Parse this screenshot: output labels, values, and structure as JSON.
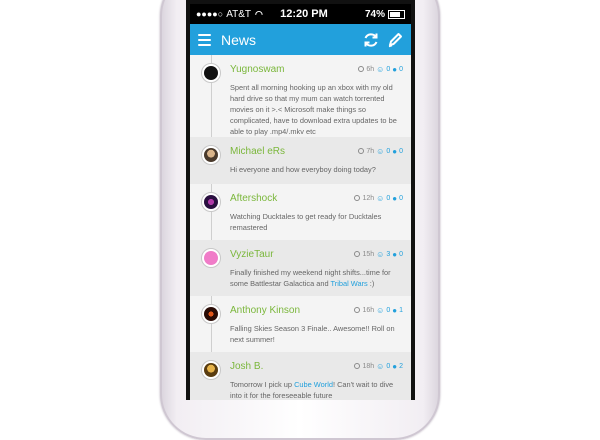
{
  "status": {
    "carrier": "AT&T",
    "time": "12:20 PM",
    "battery": "74%"
  },
  "nav": {
    "title": "News",
    "menu_icon": "hamburger-menu-icon",
    "refresh_icon": "refresh-icon",
    "compose_icon": "pencil-icon"
  },
  "posts": [
    {
      "user": "Yugnoswam",
      "time": "6h",
      "likes": "0",
      "comments": "0",
      "text_a": "Spent all morning hooking up an xbox with my old hard drive so that my mum can watch torrented movies on it >.< Microsoft make things so complicated, have to download extra updates to be able to play .mp4/.mkv etc",
      "link": "",
      "text_b": ""
    },
    {
      "user": "Michael eRs",
      "time": "7h",
      "likes": "0",
      "comments": "0",
      "text_a": "Hi everyone and how everyboy doing today?",
      "link": "",
      "text_b": ""
    },
    {
      "user": "Aftershock",
      "time": "12h",
      "likes": "0",
      "comments": "0",
      "text_a": "Watching Ducktales to get ready for Ducktales remastered",
      "link": "",
      "text_b": ""
    },
    {
      "user": "VyzieTaur",
      "time": "15h",
      "likes": "3",
      "comments": "0",
      "text_a": "Finally finished my weekend night shifts...time for some Battlestar Galactica and ",
      "link": "Tribal Wars",
      "text_b": " :)"
    },
    {
      "user": "Anthony Kinson",
      "time": "16h",
      "likes": "0",
      "comments": "1",
      "text_a": "Falling Skies Season 3 Finale.. Awesome!! Roll on next summer!",
      "link": "",
      "text_b": ""
    },
    {
      "user": "Josh B.",
      "time": "18h",
      "likes": "0",
      "comments": "2",
      "text_a": "Tomorrow I pick up ",
      "link": "Cube World",
      "text_b": "! Can't wait to dive into it for the foreseeable future"
    }
  ]
}
